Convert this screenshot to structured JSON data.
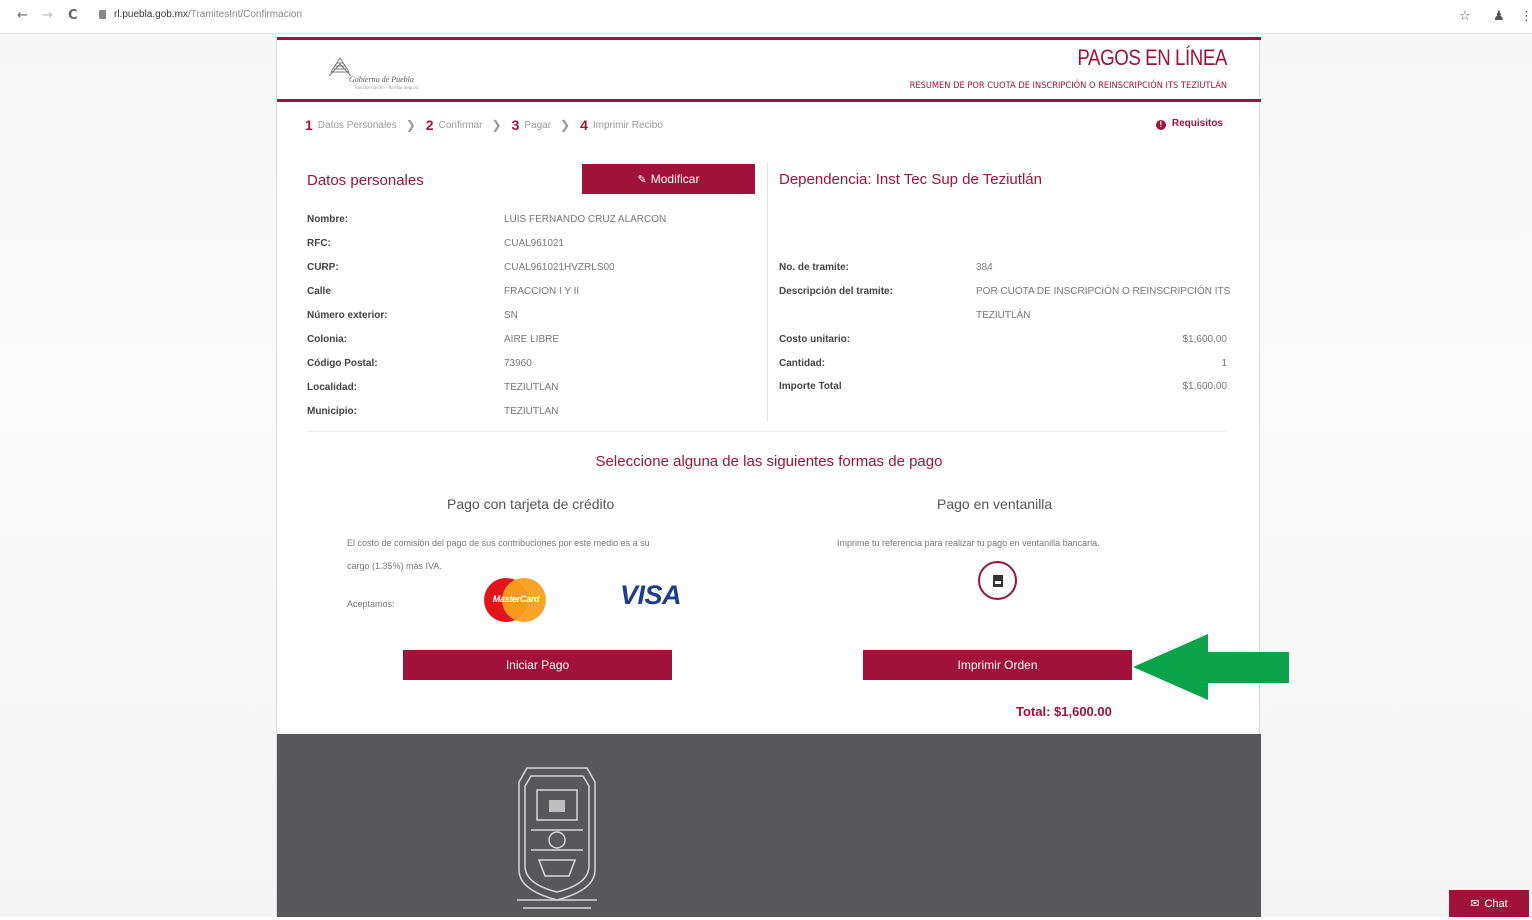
{
  "browser": {
    "back": "←",
    "forward": "→",
    "reload": "C",
    "url_host": "rl.puebla.gob.mx",
    "url_path": "/TramitesInt/Confirmacion",
    "star": "☆",
    "profile": "♟",
    "menu": "⋮"
  },
  "header": {
    "logo_text": "Gobierno de Puebla",
    "logo_sub": "Transformación · Rumbo Seguro",
    "title": "PAGOS EN LÍNEA",
    "subtitle": "RESUMEN DE POR CUOTA DE INSCRIPCIÓN O REINSCRIPCIÓN ITS TEZIUTLÁN"
  },
  "steps": [
    {
      "num": "1",
      "label": "Datos Personales"
    },
    {
      "num": "2",
      "label": "Confirmar"
    },
    {
      "num": "3",
      "label": "Pagar"
    },
    {
      "num": "4",
      "label": "Imprimir Recibo"
    }
  ],
  "requisitos": "Requisitos",
  "personal": {
    "title": "Datos personales",
    "modify_label": "Modificar",
    "fields": [
      {
        "label": "Nombre:",
        "value": "LUIS FERNANDO CRUZ ALARCON"
      },
      {
        "label": "RFC:",
        "value": "CUAL961021"
      },
      {
        "label": "CURP:",
        "value": "CUAL961021HVZRLS00"
      },
      {
        "label": "Calle",
        "value": "FRACCION I Y II"
      },
      {
        "label": "Número exterior:",
        "value": "SN"
      },
      {
        "label": "Colonia:",
        "value": "AIRE LIBRE"
      },
      {
        "label": "Código Postal:",
        "value": "73960"
      },
      {
        "label": "Localidad:",
        "value": "TEZIUTLAN"
      },
      {
        "label": "Municipio:",
        "value": "TEZIUTLAN"
      }
    ]
  },
  "dependencia": {
    "title": "Dependencia: Inst Tec Sup de Teziutlán",
    "no_tramite_label": "No. de tramite:",
    "no_tramite_value": "384",
    "descripcion_label": "Descripción del tramite:",
    "descripcion_line1": "POR CUOTA DE INSCRIPCIÓN O REINSCRIPCIÓN ITS",
    "descripcion_line2": "TEZIUTLÁN",
    "costo_label": "Costo unitario:",
    "costo_value": "$1,600.00",
    "cantidad_label": "Cantidad:",
    "cantidad_value": "1",
    "importe_label": "Importe Total",
    "importe_value": "$1,600.00"
  },
  "payment": {
    "title": "Seleccione alguna de las siguientes formas de pago",
    "card_title": "Pago con tarjeta de crédito",
    "card_text_1": "El costo de comisión del pago de sus contribuciones por este medio es a su",
    "card_text_2": "cargo (1.35%) más IVA.",
    "accept_label": "Aceptamos:",
    "mastercard": "MasterCard",
    "visa": "VISA",
    "start_button": "Iniciar Pago",
    "window_title": "Pago en ventanilla",
    "window_text": "Imprime tu referencia para realizar tu pago en ventanilla bancaria.",
    "print_button": "Imprimir Orden",
    "total": "Total: $1,600.00"
  },
  "chat": "Chat",
  "colors": {
    "brand": "#a0123b",
    "footer": "#58585a",
    "arrow": "#0aa34a"
  }
}
